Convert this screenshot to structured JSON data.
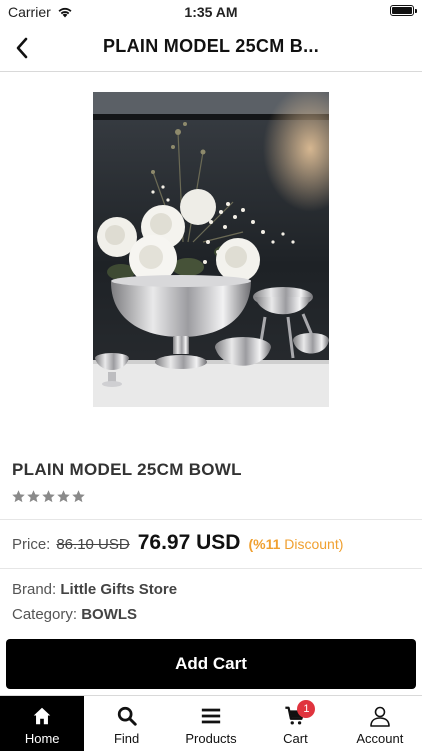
{
  "status_bar": {
    "carrier": "Carrier",
    "time": "1:35 AM"
  },
  "nav": {
    "title": "PLAIN MODEL 25CM B..."
  },
  "product": {
    "name": "PLAIN MODEL 25CM BOWL",
    "rating": 5,
    "price_label": "Price:",
    "old_price": "86.10 USD",
    "new_price": "76.97 USD",
    "discount_text": "(%11 ",
    "discount_word": "Discount)",
    "brand_label": "Brand:",
    "brand_value": "Little Gifts Store",
    "category_label": "Category:",
    "category_value": "BOWLS"
  },
  "add_cart_label": "Add Cart",
  "tabs": [
    {
      "label": "Home",
      "icon": "home-icon",
      "active": true
    },
    {
      "label": "Find",
      "icon": "search-icon"
    },
    {
      "label": "Products",
      "icon": "menu-icon"
    },
    {
      "label": "Cart",
      "icon": "cart-icon",
      "badge": "1"
    },
    {
      "label": "Account",
      "icon": "person-icon"
    }
  ],
  "colors": {
    "accent": "#000000",
    "discount": "#f0a030",
    "badge": "#e0343e"
  }
}
